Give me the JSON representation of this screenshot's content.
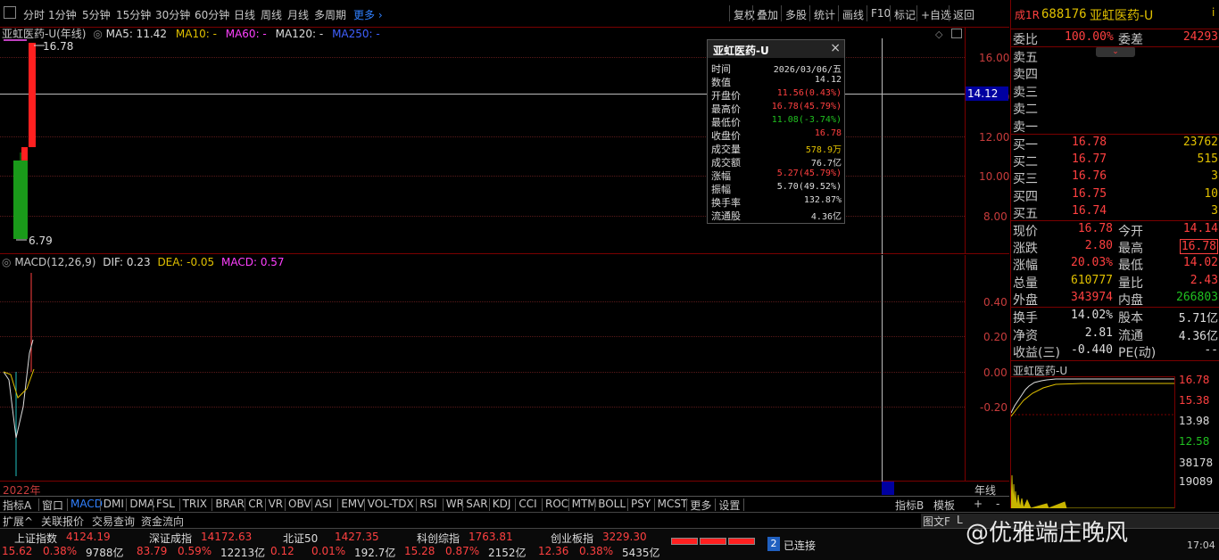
{
  "toolbar": {
    "left_items": [
      "分时",
      "1分钟",
      "5分钟",
      "15分钟",
      "30分钟",
      "60分钟",
      "日线",
      "周线",
      "月线",
      "多周期",
      "更多"
    ],
    "right_items": [
      "复权",
      "叠加",
      "多股",
      "统计",
      "画线",
      "F10",
      "标记",
      "+自选",
      "返回"
    ]
  },
  "main_chart": {
    "header": {
      "name": "亚虹医药-U(年线)",
      "ma5": "MA5: 11.42",
      "ma10": "MA10: -",
      "ma60": "MA60: -",
      "ma120": "MA120: -",
      "ma250": "MA250: -"
    },
    "high_marker": "16.78",
    "low_marker": "6.79",
    "crosshair_value": "14.12",
    "y_ticks": [
      "16.00",
      "14.00",
      "12.00",
      "10.00",
      "8.00"
    ]
  },
  "macd_chart": {
    "header": {
      "name": "MACD(12,26,9)",
      "dif": "DIF: 0.23",
      "dea": "DEA: -0.05",
      "macd": "MACD: 0.57"
    },
    "y_ticks": [
      "0.40",
      "0.20",
      "0.00",
      "-0.20"
    ]
  },
  "x_axis": {
    "year_label": "2022年",
    "period_label": "年线"
  },
  "popup": {
    "title": "亚虹医药-U",
    "rows": [
      {
        "k": "时间",
        "v": "2026/03/06/五",
        "color": "#dddddd"
      },
      {
        "k": "数值",
        "v": "14.12",
        "color": "#dddddd"
      },
      {
        "k": "开盘价",
        "v": "11.56(0.43%)",
        "color": "#ff4040"
      },
      {
        "k": "最高价",
        "v": "16.78(45.79%)",
        "color": "#ff4040"
      },
      {
        "k": "最低价",
        "v": "11.08(-3.74%)",
        "color": "#20c020"
      },
      {
        "k": "收盘价",
        "v": "16.78",
        "color": "#ff4040"
      },
      {
        "k": "成交量",
        "v": "578.9万",
        "color": "#e0c000"
      },
      {
        "k": "成交额",
        "v": "76.7亿",
        "color": "#dddddd"
      },
      {
        "k": "涨幅",
        "v": "5.27(45.79%)",
        "color": "#ff4040"
      },
      {
        "k": "振幅",
        "v": "5.70(49.52%)",
        "color": "#dddddd"
      },
      {
        "k": "换手率",
        "v": "132.87%",
        "color": "#dddddd"
      },
      {
        "k": "流通股",
        "v": "4.36亿",
        "color": "#dddddd"
      }
    ]
  },
  "right_panel": {
    "code": "688176",
    "name": "亚虹医药-U",
    "prefix": "成1R",
    "weibi_label": "委比",
    "weibi_value": "100.00%",
    "weicha_label": "委差",
    "weicha_value": "24293",
    "sell": [
      {
        "label": "卖五",
        "price": "",
        "vol": ""
      },
      {
        "label": "卖四",
        "price": "",
        "vol": ""
      },
      {
        "label": "卖三",
        "price": "",
        "vol": ""
      },
      {
        "label": "卖二",
        "price": "",
        "vol": ""
      },
      {
        "label": "卖一",
        "price": "",
        "vol": ""
      }
    ],
    "buy": [
      {
        "label": "买一",
        "price": "16.78",
        "vol": "23762"
      },
      {
        "label": "买二",
        "price": "16.77",
        "vol": "515"
      },
      {
        "label": "买三",
        "price": "16.76",
        "vol": "3"
      },
      {
        "label": "买四",
        "price": "16.75",
        "vol": "10"
      },
      {
        "label": "买五",
        "price": "16.74",
        "vol": "3"
      }
    ],
    "quote": [
      {
        "l1": "现价",
        "v1": "16.78",
        "c1": "#ff4040",
        "l2": "今开",
        "v2": "14.14",
        "c2": "#ff4040"
      },
      {
        "l1": "涨跌",
        "v1": "2.80",
        "c1": "#ff4040",
        "l2": "最高",
        "v2": "16.78",
        "c2": "#ff4040"
      },
      {
        "l1": "涨幅",
        "v1": "20.03%",
        "c1": "#ff4040",
        "l2": "最低",
        "v2": "14.02",
        "c2": "#ff4040"
      },
      {
        "l1": "总量",
        "v1": "610777",
        "c1": "#e0c000",
        "l2": "量比",
        "v2": "2.43",
        "c2": "#ff4040"
      },
      {
        "l1": "外盘",
        "v1": "343974",
        "c1": "#ff4040",
        "l2": "内盘",
        "v2": "266803",
        "c2": "#20c020"
      }
    ],
    "fundamental": [
      {
        "l1": "换手",
        "v1": "14.02%",
        "l2": "股本",
        "v2": "5.71亿"
      },
      {
        "l1": "净资",
        "v1": "2.81",
        "l2": "流通",
        "v2": "4.36亿"
      },
      {
        "l1": "收益(三)",
        "v1": "-0.440",
        "l2": "PE(动)",
        "v2": "--"
      }
    ],
    "mini_title": "亚虹医药-U",
    "mini_ticks": [
      "16.78",
      "15.38",
      "13.98",
      "12.58"
    ],
    "mini_vol_ticks": [
      "38178",
      "19089"
    ]
  },
  "indicator_tabs": {
    "items": [
      "指标A",
      "窗口",
      "MACD",
      "DMI",
      "DMA",
      "FSL",
      "TRIX",
      "BRAR",
      "CR",
      "VR",
      "OBV",
      "ASI",
      "EMV",
      "VOL-TDX",
      "RSI",
      "WR",
      "SAR",
      "KDJ",
      "CCI",
      "ROC",
      "MTM",
      "BOLL",
      "PSY",
      "MCST",
      "更多",
      "设置"
    ],
    "right_items": [
      "指标B",
      "模板",
      "+",
      "-"
    ]
  },
  "sub_tabs": {
    "items": [
      "扩展^",
      "关联报价",
      "交易查询",
      "资金流向"
    ],
    "right_items": [
      "图文F",
      "L"
    ]
  },
  "status_bar": {
    "indices": [
      {
        "name": "上证指数",
        "value": "4124.19",
        "chg": "15.62",
        "pct": "0.38%",
        "amt": "9788亿"
      },
      {
        "name": "深证成指",
        "value": "14172.63",
        "chg": "83.79",
        "pct": "0.59%",
        "amt": "12213亿"
      },
      {
        "name": "北证50",
        "value": "1427.35",
        "chg": "0.12",
        "pct": "0.01%",
        "amt": "192.7亿"
      },
      {
        "name": "科创综指",
        "value": "1763.81",
        "chg": "15.28",
        "pct": "0.87%",
        "amt": "2152亿"
      },
      {
        "name": "创业板指",
        "value": "3229.30",
        "chg": "12.36",
        "pct": "0.38%",
        "amt": "5435亿"
      }
    ],
    "connection_count": "2",
    "connection_label": "已连接",
    "watermark": "@优雅端庄晚风",
    "time": "17:04"
  }
}
